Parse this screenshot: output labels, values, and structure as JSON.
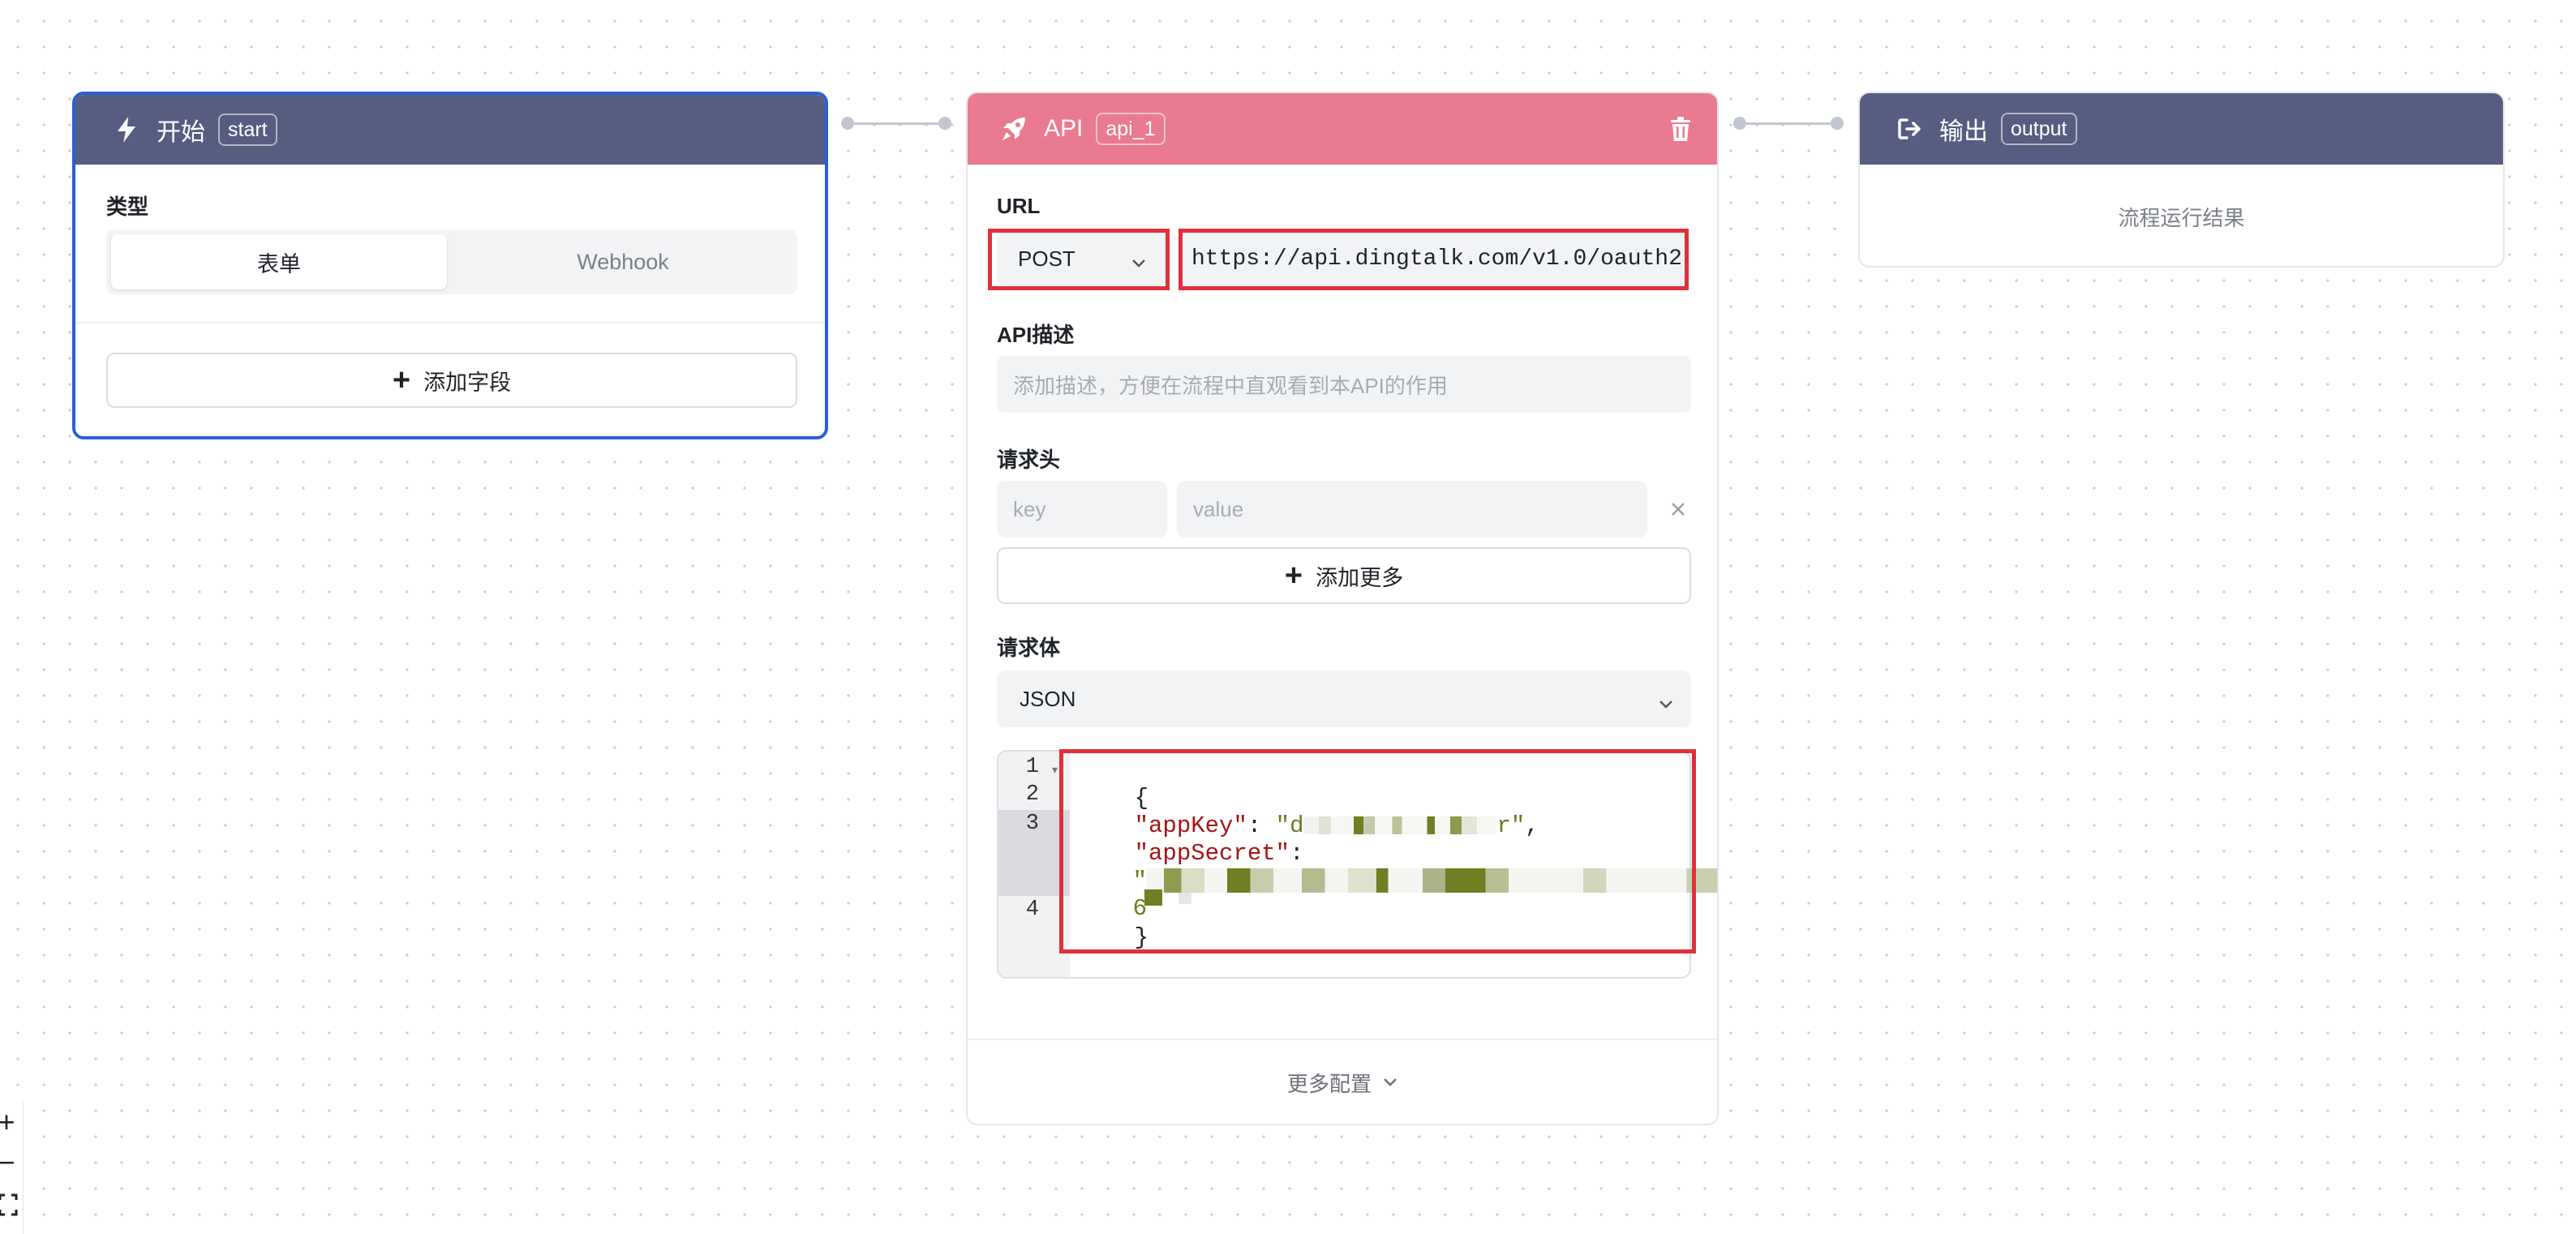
{
  "colors": {
    "start_header": "#575d80",
    "api_header": "#ea7a8f",
    "output_header": "#575d80",
    "selected_border": "#2a60d4",
    "highlight_red": "#e1303a",
    "json_key": "#a31515",
    "json_string": "#6b7b1c"
  },
  "start_node": {
    "icon": "lightning-icon",
    "title": "开始",
    "tag": "start",
    "type_label": "类型",
    "options": [
      "表单",
      "Webhook"
    ],
    "selected_option": "表单",
    "add_field_label": "添加字段"
  },
  "api_node": {
    "icon": "rocket-icon",
    "title": "API",
    "tag": "api_1",
    "delete_icon": "trash-icon",
    "url_label": "URL",
    "method": "POST",
    "url": "https://api.dingtalk.com/v1.0/oauth2",
    "desc_label": "API描述",
    "desc_placeholder": "添加描述，方便在流程中直观看到本API的作用",
    "headers_label": "请求头",
    "key_placeholder": "key",
    "value_placeholder": "value",
    "add_more_label": "添加更多",
    "body_label": "请求体",
    "body_type": "JSON",
    "code": {
      "line_numbers": [
        "1",
        "2",
        "3",
        "4"
      ],
      "open_brace": "{",
      "key1": "\"appKey\"",
      "colon1": ": ",
      "val1_start": "\"d",
      "val1_end": "r\"",
      "comma1": ",",
      "key2": "\"appSecret\"",
      "colon2": ":",
      "val2_start": "\"",
      "val2_end": "j",
      "val2_tail": "6",
      "close_brace": "}"
    },
    "more_config_label": "更多配置"
  },
  "output_node": {
    "icon": "exit-icon",
    "title": "输出",
    "tag": "output",
    "placeholder": "流程运行结果"
  },
  "zoom_controls": {
    "zoom_in": "+",
    "zoom_out": "−",
    "fit": "fit-view-icon"
  }
}
